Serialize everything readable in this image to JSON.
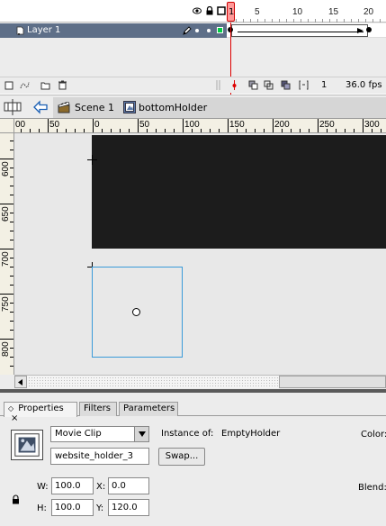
{
  "timeline": {
    "frame_numbers": [
      "1",
      "5",
      "10",
      "15",
      "20"
    ],
    "layer": {
      "name": "Layer 1"
    },
    "footer": {
      "current_frame": "1",
      "fps": "36.0 fps"
    }
  },
  "editbar": {
    "scene_label": "Scene 1",
    "symbol_label": "bottomHolder"
  },
  "rulers": {
    "horizontal": [
      "00",
      "50",
      "0",
      "50",
      "100",
      "150",
      "200",
      "250",
      "300"
    ],
    "vertical": [
      "600",
      "650",
      "700",
      "750",
      "800"
    ]
  },
  "properties": {
    "tabs": [
      "Properties",
      "Filters",
      "Parameters"
    ],
    "symbol_type": "Movie Clip",
    "instance_of_label": "Instance of:",
    "instance_of_value": "EmptyHolder",
    "color_label": "Color:",
    "instance_name": "website_holder_3",
    "swap_label": "Swap...",
    "blend_label": "Blend:",
    "width_label": "W:",
    "width_value": "100.0",
    "height_label": "H:",
    "height_value": "100.0",
    "x_label": "X:",
    "x_value": "0.0",
    "y_label": "Y:",
    "y_value": "120.0"
  },
  "colors": {
    "layer_selected": "#5e6f88",
    "playhead": "#dd0000",
    "selection": "#3a9ad9",
    "dark_block": "#1c1c1c"
  }
}
